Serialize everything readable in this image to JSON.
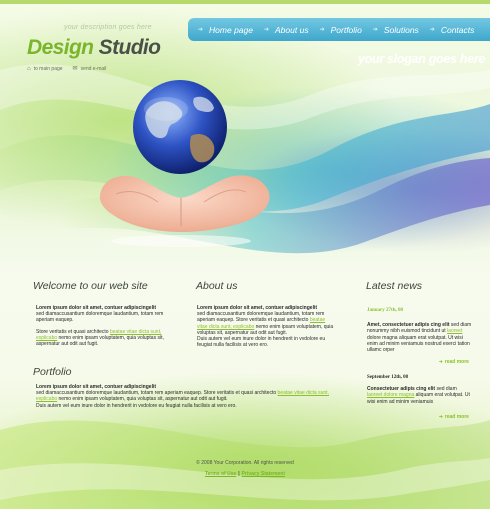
{
  "header": {
    "tagline": "your description goes here",
    "logo_part1": "Design",
    "logo_part2": "Studio",
    "util_home": "to main page",
    "util_email": "send e-mail",
    "slogan": "your slogan goes here"
  },
  "nav": {
    "items": [
      {
        "label": "Home page"
      },
      {
        "label": "About us"
      },
      {
        "label": "Portfolio"
      },
      {
        "label": "Solutions"
      },
      {
        "label": "Contacts"
      }
    ]
  },
  "welcome": {
    "title": "Welcome to our web site",
    "p1_bold": "Lorem ipsum dolor sit amet, contuer adipiscingelit",
    "p1_text": "sed diamaccusantium doloremque laudantium, totam rem aperiam eaquep.",
    "p2_a": "Store veritatis et quasi architecto ",
    "p2_link": "beatae vitae dicta sunt, explicabo",
    "p2_b": " nemo enim ipsam voluptatem, quia voluptas sit, aspernatur aut odit aut fugit."
  },
  "about": {
    "title": "About us",
    "p1_bold": "Lorem ipsum dolor sit amet, contuer adipiscingelit",
    "p1_a": "sed diamaccusantium doloremque laudantium, totam rem aperiam eaquep. Store veritatis et quasi architecto ",
    "p1_link": "beatae vitae dicta sunt, explicabo",
    "p1_b": " nemo enim ipsam voluptatem, quia voluptas sit, aspernatur aut odit aut fugit.",
    "p1_c": "Duis autem vel eum inure dolor in hendrerit in vvdolore eu feugiat nulla facilisis at vero ero."
  },
  "portfolio": {
    "title": "Portfolio",
    "p1_bold": "Lorem ipsum dolor sit amet, contuer adipiscingelit",
    "p1_a": "sed diamaccusantium doloremque laudantium, totam rem aperiam eaquep. Store veritatis et quasi architecto ",
    "p1_link": "beatae vitae dicta sunt, explicabo",
    "p1_b": " nemo enim ipsam voluptatem, quia voluptas sit, aspernatur aut odit aut fugit.",
    "p1_c": "Duis autem vel eum inure dolor in hendrerit in vvdolore eu feugiat nulla facilisis at vero ero."
  },
  "news": {
    "title": "Latest news",
    "item1": {
      "date": "January 27th, 08",
      "head": "Amet, consectetuer adipis cing elit",
      "a": " sed diam nonummy nibh euismod tincidunt ut ",
      "link": "laoreet",
      "b": " dolore magna aliquam erat volutpat.  Ut wisi enim ad minim veniamuis nostrud exerci tation ullamc orper"
    },
    "item2": {
      "date": "September 12th, 08",
      "head": "Consectetuer adipis cing elit",
      "a": " sed diam ",
      "link": "laoreet dolore magna",
      "b": " aliquam erat volutpat.  Ut wisi enim ad minim veniamuis"
    },
    "read_more": "read more"
  },
  "footer": {
    "copyright": "© 2008 Your Corporation. All rights reserved",
    "terms": "Terms of Use",
    "sep": "|",
    "privacy": "Privacy Statement"
  },
  "colors": {
    "accent_green": "#7bb52b",
    "nav_blue": "#3ea7cc",
    "logo_gray": "#4a4f47"
  }
}
